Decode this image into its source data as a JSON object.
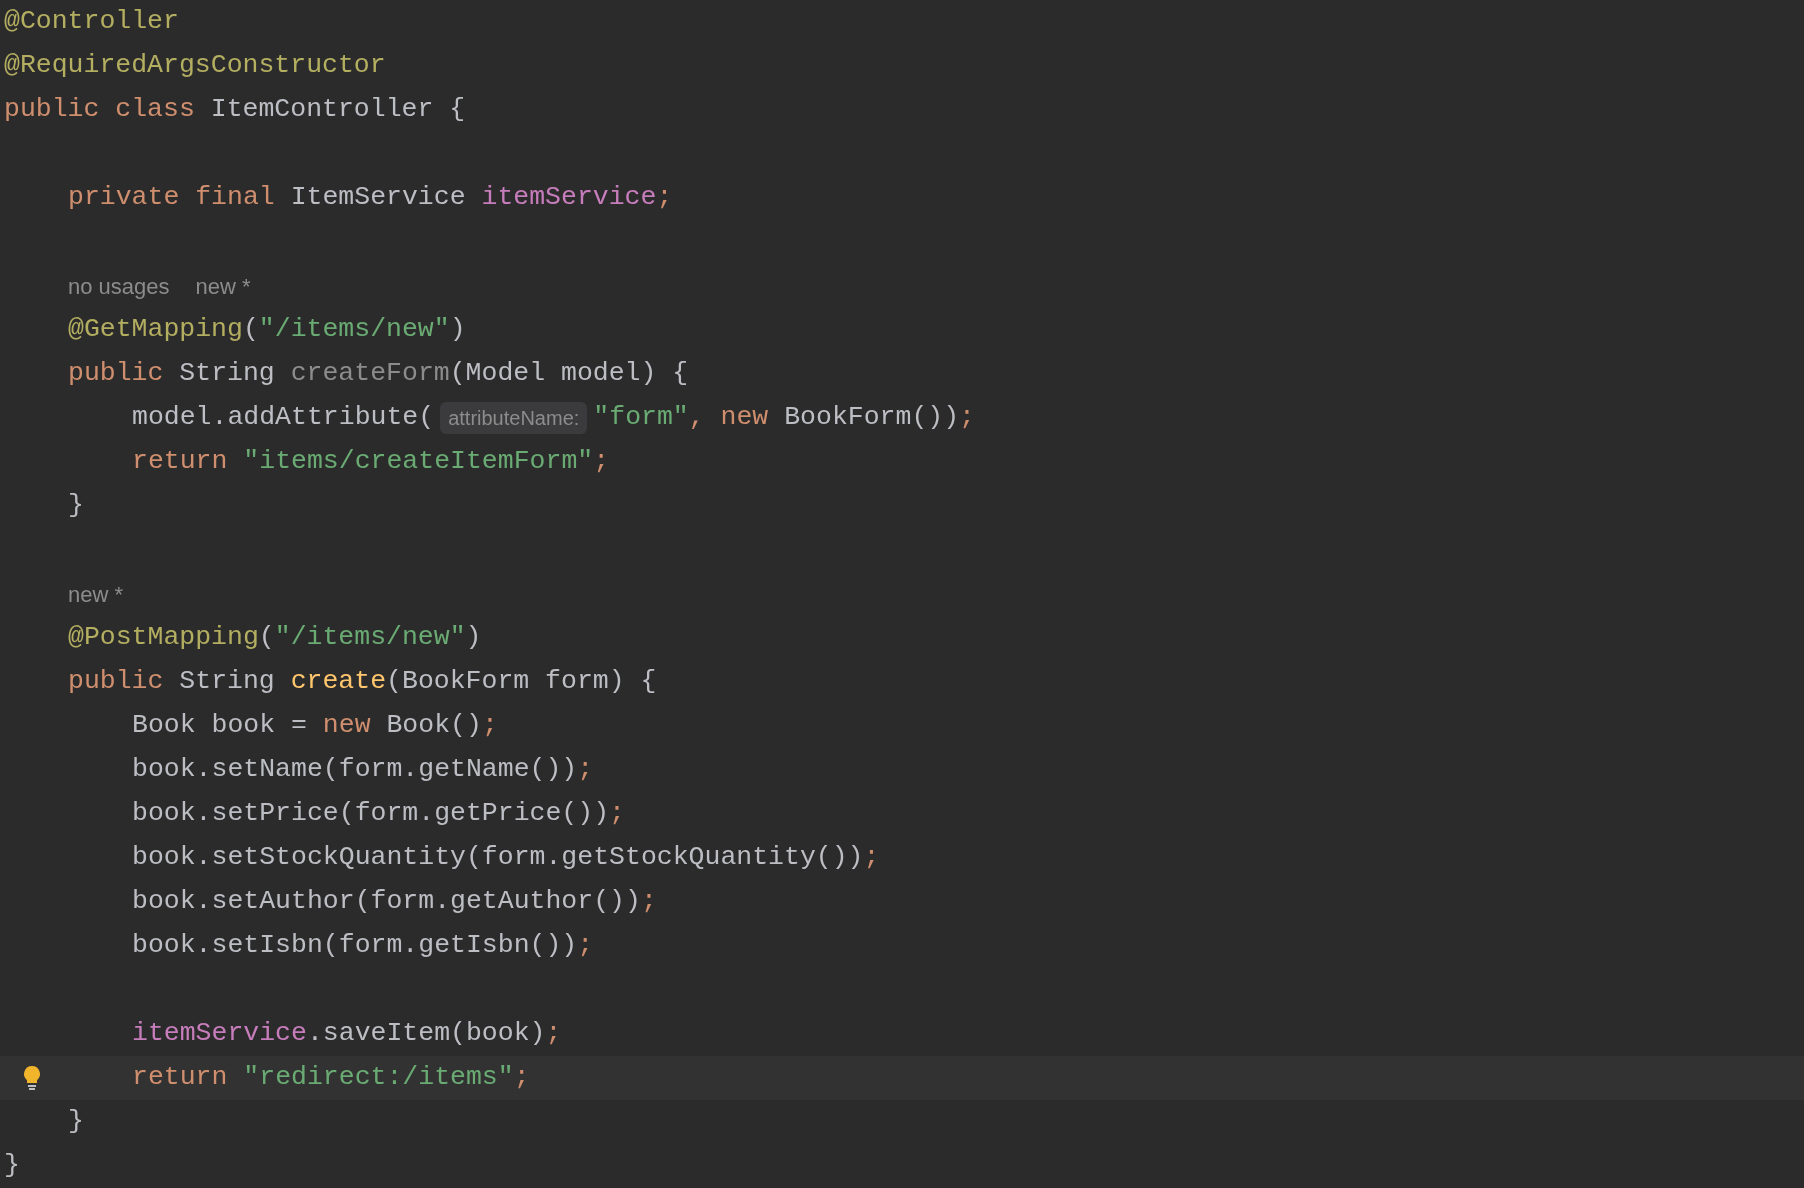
{
  "editor": {
    "lines": [
      {
        "kind": "top",
        "tokens": [
          {
            "kind": "annotation",
            "text": "@Controller"
          }
        ]
      },
      {
        "kind": "top",
        "tokens": [
          {
            "kind": "annotation",
            "text": "@RequiredArgsConstructor"
          }
        ]
      },
      {
        "kind": "top",
        "tokens": [
          {
            "kind": "keyword",
            "text": "public class "
          },
          {
            "kind": "plain",
            "text": "ItemController {"
          }
        ]
      },
      {
        "kind": "blank"
      },
      {
        "kind": "member",
        "tokens": [
          {
            "kind": "keyword",
            "text": "private final "
          },
          {
            "kind": "plain",
            "text": "ItemService "
          },
          {
            "kind": "field",
            "text": "itemService"
          },
          {
            "kind": "keyword",
            "text": ";"
          }
        ]
      },
      {
        "kind": "blank"
      },
      {
        "kind": "inlay",
        "hints": [
          "no usages",
          "new *"
        ]
      },
      {
        "kind": "member",
        "tokens": [
          {
            "kind": "annotation",
            "text": "@GetMapping"
          },
          {
            "kind": "plain",
            "text": "("
          },
          {
            "kind": "string",
            "text": "\"/items/new\""
          },
          {
            "kind": "plain",
            "text": ")"
          }
        ]
      },
      {
        "kind": "member",
        "tokens": [
          {
            "kind": "keyword",
            "text": "public "
          },
          {
            "kind": "plain",
            "text": "String "
          },
          {
            "kind": "unused",
            "text": "createForm"
          },
          {
            "kind": "plain",
            "text": "(Model model) {"
          }
        ]
      },
      {
        "kind": "body",
        "tokens": [
          {
            "kind": "plain",
            "text": "model.addAttribute("
          },
          {
            "kind": "hint",
            "text": "attributeName:"
          },
          {
            "kind": "string",
            "text": "\"form\""
          },
          {
            "kind": "keyword",
            "text": ", new "
          },
          {
            "kind": "plain",
            "text": "BookForm())"
          },
          {
            "kind": "keyword",
            "text": ";"
          }
        ]
      },
      {
        "kind": "body",
        "tokens": [
          {
            "kind": "keyword",
            "text": "return "
          },
          {
            "kind": "string",
            "text": "\"items/createItemForm\""
          },
          {
            "kind": "keyword",
            "text": ";"
          }
        ]
      },
      {
        "kind": "member",
        "tokens": [
          {
            "kind": "plain",
            "text": "}"
          }
        ]
      },
      {
        "kind": "blank"
      },
      {
        "kind": "inlay",
        "hints": [
          "new *"
        ]
      },
      {
        "kind": "member",
        "tokens": [
          {
            "kind": "annotation",
            "text": "@PostMapping"
          },
          {
            "kind": "plain",
            "text": "("
          },
          {
            "kind": "string",
            "text": "\"/items/new\""
          },
          {
            "kind": "plain",
            "text": ")"
          }
        ]
      },
      {
        "kind": "member",
        "tokens": [
          {
            "kind": "keyword",
            "text": "public "
          },
          {
            "kind": "plain",
            "text": "String "
          },
          {
            "kind": "method",
            "text": "create"
          },
          {
            "kind": "plain",
            "text": "(BookForm form) {"
          }
        ]
      },
      {
        "kind": "body",
        "tokens": [
          {
            "kind": "plain",
            "text": "Book book = "
          },
          {
            "kind": "keyword",
            "text": "new "
          },
          {
            "kind": "plain",
            "text": "Book()"
          },
          {
            "kind": "keyword",
            "text": ";"
          }
        ]
      },
      {
        "kind": "body",
        "tokens": [
          {
            "kind": "plain",
            "text": "book.setName(form.getName())"
          },
          {
            "kind": "keyword",
            "text": ";"
          }
        ]
      },
      {
        "kind": "body",
        "tokens": [
          {
            "kind": "plain",
            "text": "book.setPrice(form.getPrice())"
          },
          {
            "kind": "keyword",
            "text": ";"
          }
        ]
      },
      {
        "kind": "body",
        "tokens": [
          {
            "kind": "plain",
            "text": "book.setStockQuantity(form.getStockQuantity())"
          },
          {
            "kind": "keyword",
            "text": ";"
          }
        ]
      },
      {
        "kind": "body",
        "tokens": [
          {
            "kind": "plain",
            "text": "book.setAuthor(form.getAuthor())"
          },
          {
            "kind": "keyword",
            "text": ";"
          }
        ]
      },
      {
        "kind": "body",
        "tokens": [
          {
            "kind": "plain",
            "text": "book.setIsbn(form.getIsbn())"
          },
          {
            "kind": "keyword",
            "text": ";"
          }
        ]
      },
      {
        "kind": "blank"
      },
      {
        "kind": "body",
        "tokens": [
          {
            "kind": "field",
            "text": "itemService"
          },
          {
            "kind": "plain",
            "text": ".saveItem(book)"
          },
          {
            "kind": "keyword",
            "text": ";"
          }
        ]
      },
      {
        "kind": "body",
        "current": true,
        "bulb": true,
        "tokens": [
          {
            "kind": "keyword",
            "text": "return "
          },
          {
            "kind": "string",
            "text": "\"redirect:/items\""
          },
          {
            "kind": "keyword",
            "text": ";"
          }
        ]
      },
      {
        "kind": "member",
        "tokens": [
          {
            "kind": "plain",
            "text": "}"
          }
        ]
      },
      {
        "kind": "top",
        "tokens": [
          {
            "kind": "plain",
            "text": "}"
          }
        ]
      }
    ]
  }
}
